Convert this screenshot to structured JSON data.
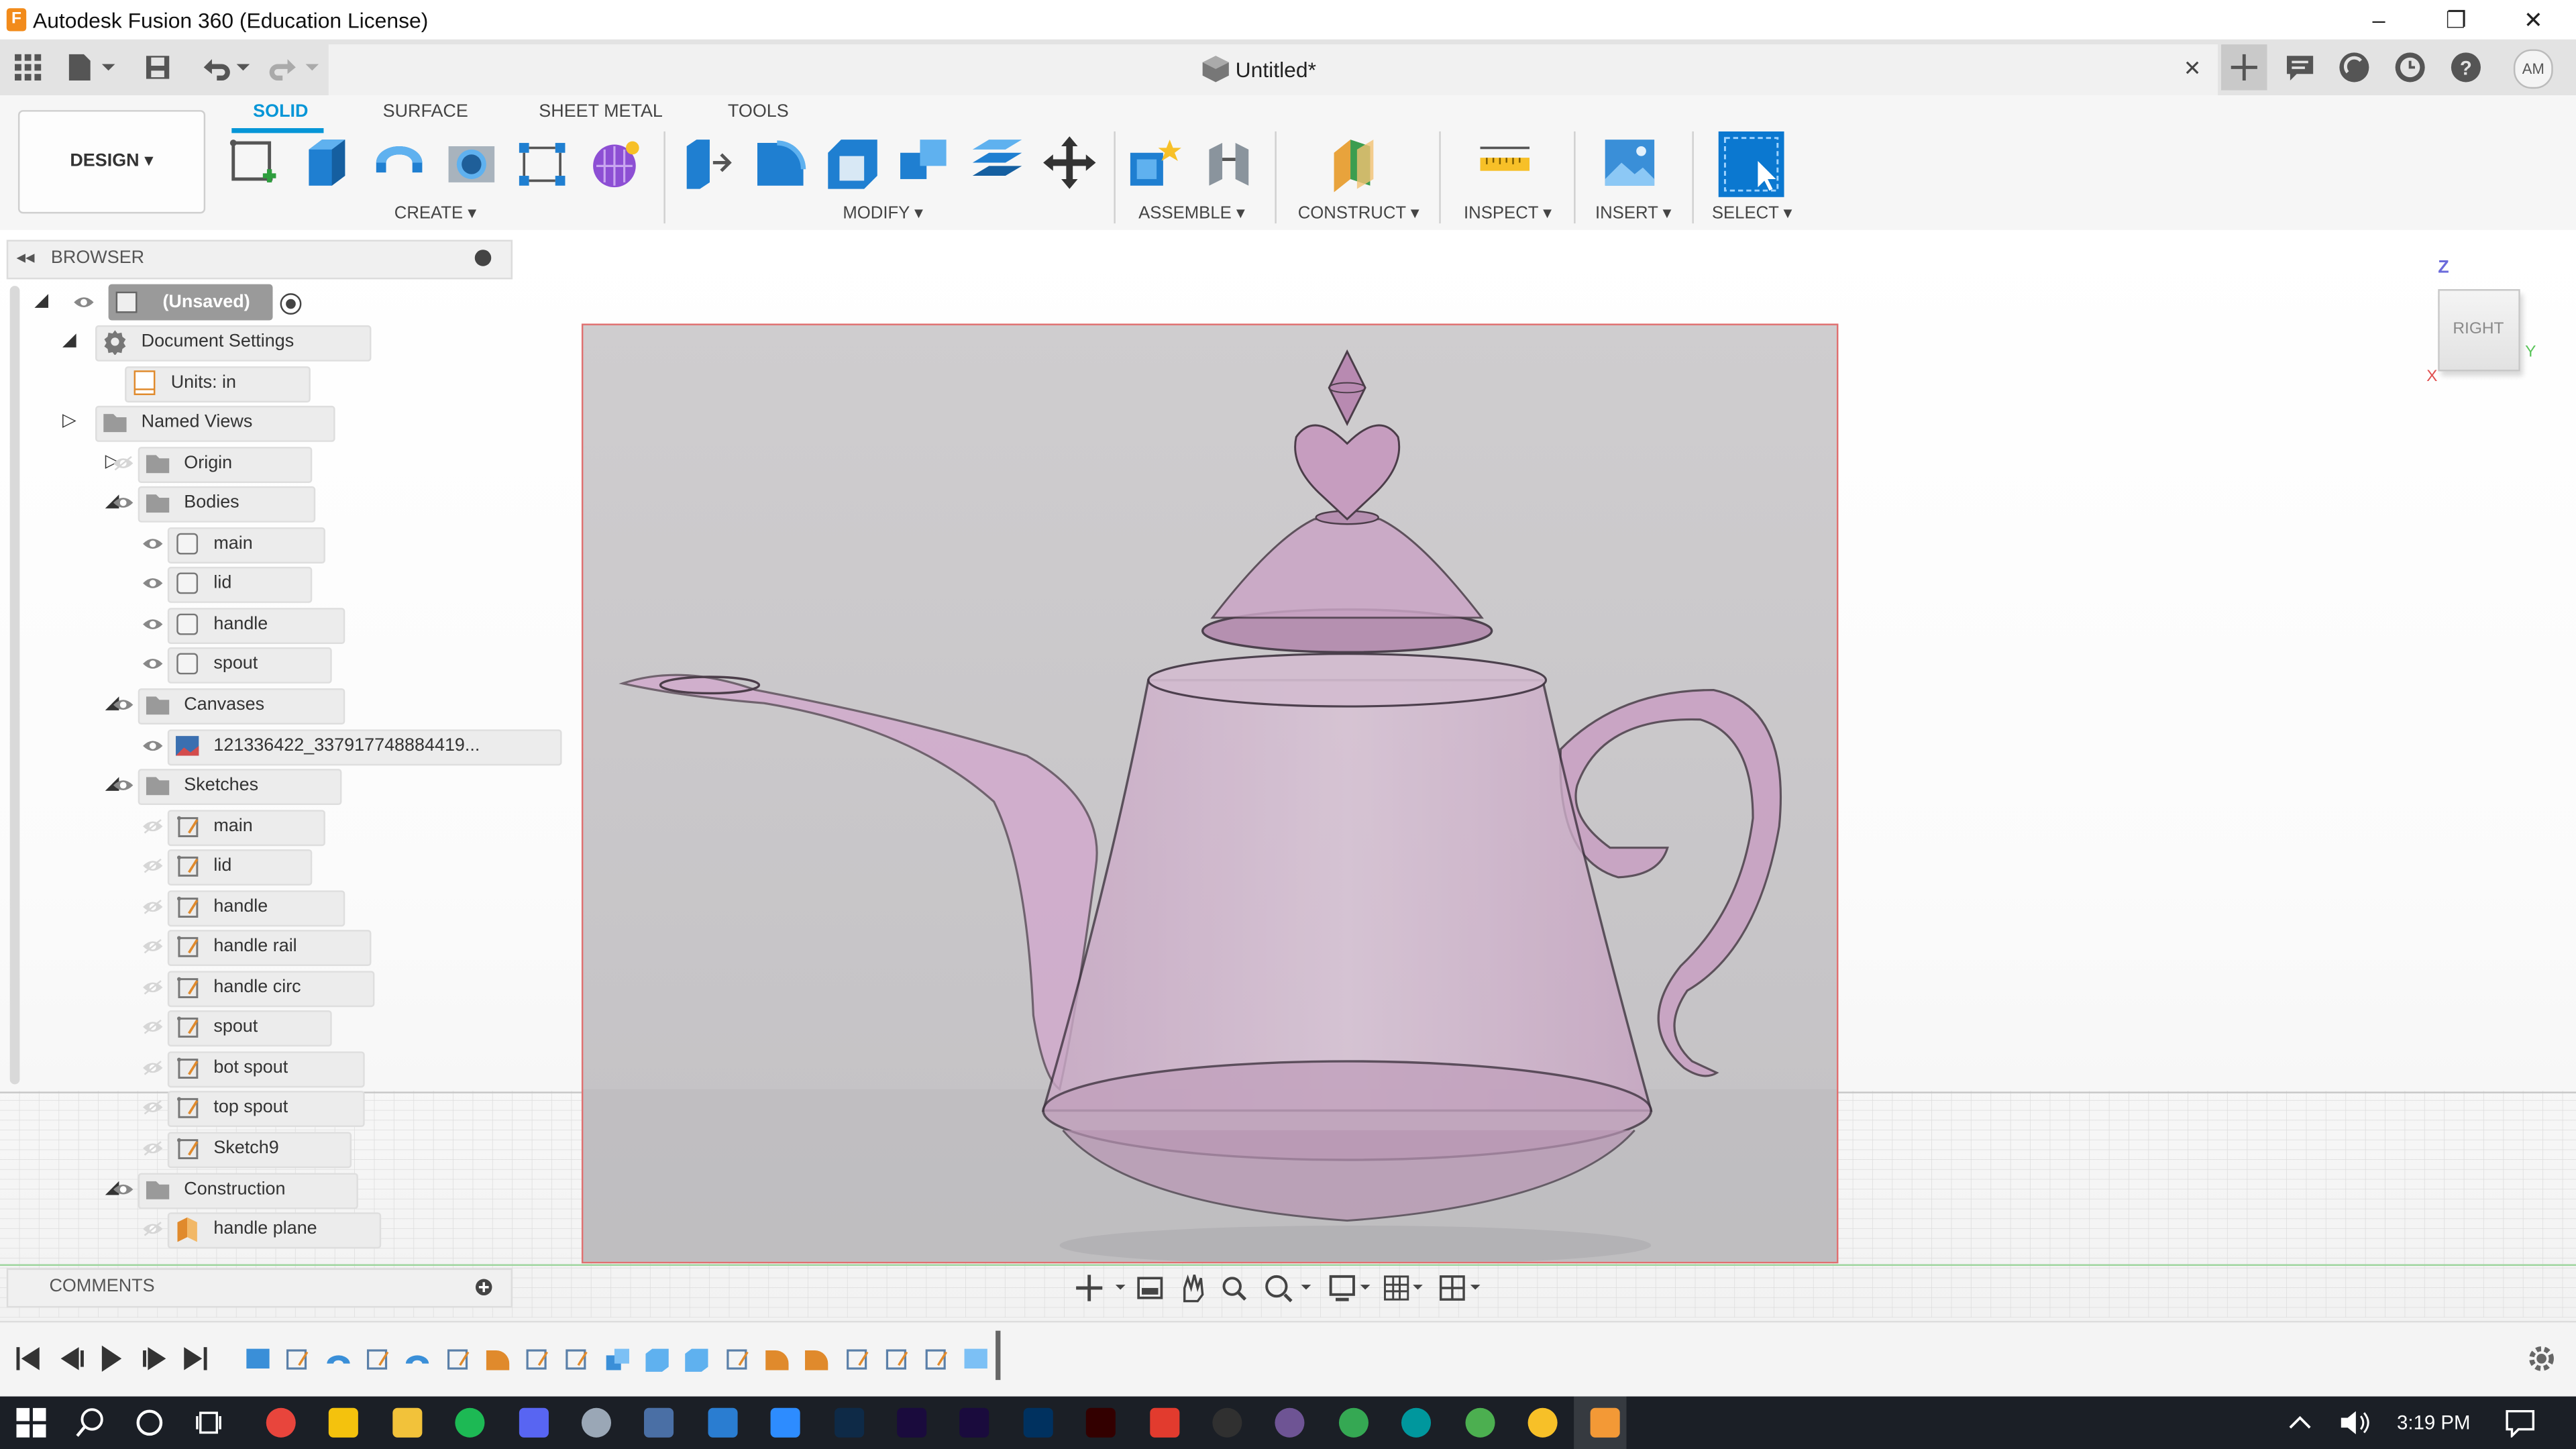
{
  "window": {
    "title": "Autodesk Fusion 360 (Education License)",
    "minimize": "–",
    "restore": "❐",
    "close": "✕"
  },
  "document": {
    "title": "Untitled*",
    "close": "✕"
  },
  "user": {
    "initials": "AM"
  },
  "workspace": {
    "label": "DESIGN ▾"
  },
  "ribbon": {
    "tabs": [
      "SOLID",
      "SURFACE",
      "SHEET METAL",
      "TOOLS"
    ],
    "active_tab": "SOLID",
    "groups": [
      "CREATE ▾",
      "MODIFY ▾",
      "ASSEMBLE ▾",
      "CONSTRUCT ▾",
      "INSPECT ▾",
      "INSERT ▾",
      "SELECT ▾"
    ]
  },
  "browser": {
    "title": "BROWSER",
    "root": "(Unsaved)",
    "items": [
      {
        "label": "Document Settings",
        "icon": "gear-icon"
      },
      {
        "label": "Units: in",
        "icon": "units-icon"
      },
      {
        "label": "Named Views",
        "icon": "folder-icon"
      },
      {
        "label": "Origin",
        "icon": "folder-icon"
      },
      {
        "label": "Bodies",
        "icon": "folder-icon"
      },
      {
        "label": "main",
        "icon": "body-icon"
      },
      {
        "label": "lid",
        "icon": "body-icon"
      },
      {
        "label": "handle",
        "icon": "body-icon"
      },
      {
        "label": "spout",
        "icon": "body-icon"
      },
      {
        "label": "Canvases",
        "icon": "folder-icon"
      },
      {
        "label": "121336422_337917748884419...",
        "icon": "canvas-icon"
      },
      {
        "label": "Sketches",
        "icon": "folder-icon"
      },
      {
        "label": "main",
        "icon": "sketch-icon"
      },
      {
        "label": "lid",
        "icon": "sketch-icon"
      },
      {
        "label": "handle",
        "icon": "sketch-icon"
      },
      {
        "label": "handle rail",
        "icon": "sketch-icon"
      },
      {
        "label": "handle circ",
        "icon": "sketch-icon"
      },
      {
        "label": "spout",
        "icon": "sketch-icon"
      },
      {
        "label": "bot spout",
        "icon": "sketch-icon"
      },
      {
        "label": "top spout",
        "icon": "sketch-icon"
      },
      {
        "label": "Sketch9",
        "icon": "sketch-icon"
      },
      {
        "label": "Construction",
        "icon": "folder-icon"
      },
      {
        "label": "handle plane",
        "icon": "plane-icon"
      }
    ]
  },
  "comments": {
    "title": "COMMENTS"
  },
  "viewcube": {
    "face": "RIGHT",
    "axis_z": "Z",
    "axis_y": "Y",
    "axis_x": "X"
  },
  "taskbar": {
    "time": "3:19 PM"
  },
  "colors": {
    "accent": "#0696d7",
    "canvas_border": "#e07070",
    "taskbar": "#1b1f26",
    "teapot_tint": "#c9a3c4"
  }
}
